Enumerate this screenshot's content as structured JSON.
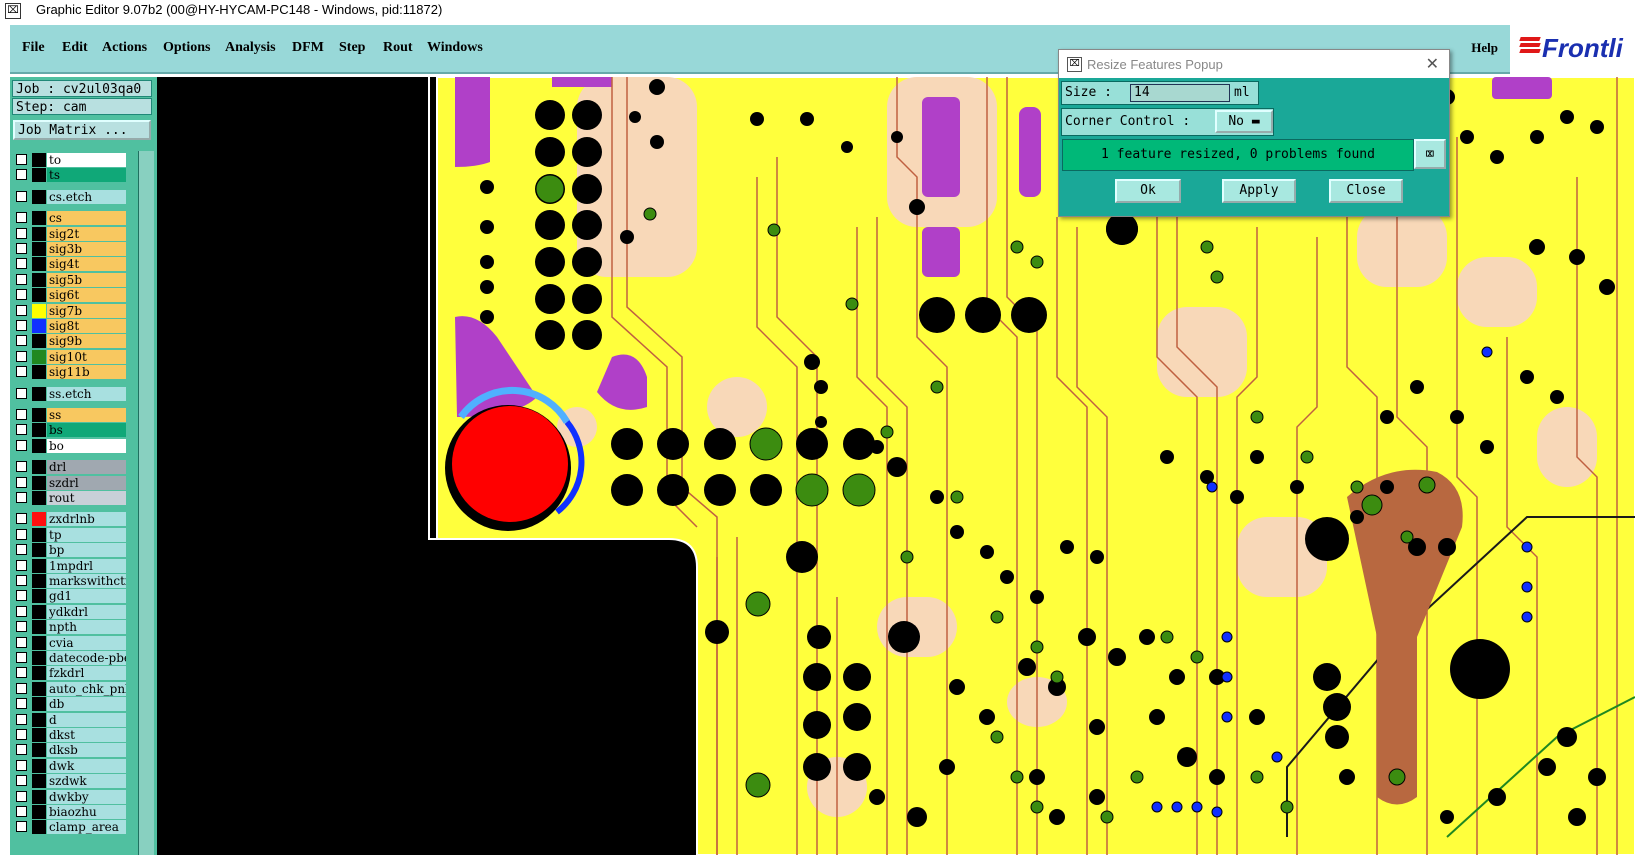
{
  "window": {
    "title": "Graphic Editor 9.07b2 (00@HY-HYCAM-PC148 - Windows, pid:11872)"
  },
  "menu": [
    "File",
    "Edit",
    "Actions",
    "Options",
    "Analysis",
    "DFM",
    "Step",
    "Rout",
    "Windows"
  ],
  "help": "Help",
  "logo": "Frontli",
  "job": {
    "job_label": "Job : cv2ul03qa0",
    "step_label": "Step: cam",
    "matrix_button": "Job Matrix ..."
  },
  "layers": [
    {
      "name": "to",
      "bg": "#ffffff",
      "sw": "#000000"
    },
    {
      "name": "ts",
      "bg": "#10a878",
      "sw": "#000000"
    },
    {
      "name": "cs.etch",
      "bg": "#a8e0e0",
      "sw": "#000000",
      "gap": true
    },
    {
      "name": "cs",
      "bg": "#f8c860",
      "sw": "#000000",
      "gap": true
    },
    {
      "name": "sig2t",
      "bg": "#f8c860",
      "sw": "#000000"
    },
    {
      "name": "sig3b",
      "bg": "#f8c860",
      "sw": "#000000"
    },
    {
      "name": "sig4t",
      "bg": "#f8c860",
      "sw": "#000000"
    },
    {
      "name": "sig5b",
      "bg": "#f8c860",
      "sw": "#000000"
    },
    {
      "name": "sig6t",
      "bg": "#f8c860",
      "sw": "#000000"
    },
    {
      "name": "sig7b",
      "bg": "#f8c860",
      "sw": "#ffff00"
    },
    {
      "name": "sig8t",
      "bg": "#f8c860",
      "sw": "#1030ff"
    },
    {
      "name": "sig9b",
      "bg": "#f8c860",
      "sw": "#000000"
    },
    {
      "name": "sig10t",
      "bg": "#f8c860",
      "sw": "#208820"
    },
    {
      "name": "sig11b",
      "bg": "#f8c860",
      "sw": "#000000"
    },
    {
      "name": "ss.etch",
      "bg": "#a8e0e0",
      "sw": "#000000",
      "gap": true
    },
    {
      "name": "ss",
      "bg": "#f8c860",
      "sw": "#000000",
      "gap": true
    },
    {
      "name": "bs",
      "bg": "#10a878",
      "sw": "#000000"
    },
    {
      "name": "bo",
      "bg": "#ffffff",
      "sw": "#000000"
    },
    {
      "name": "drl",
      "bg": "#a0a8b0",
      "sw": "#000000",
      "gap": true
    },
    {
      "name": "szdrl",
      "bg": "#a0a8b0",
      "sw": "#000000"
    },
    {
      "name": "rout",
      "bg": "#c8d0d8",
      "sw": "#000000"
    },
    {
      "name": "zxdrlnb",
      "bg": "#a8e0e0",
      "sw": "#ff1010",
      "gap": true
    },
    {
      "name": "tp",
      "bg": "#a8e0e0",
      "sw": "#000000"
    },
    {
      "name": "bp",
      "bg": "#a8e0e0",
      "sw": "#000000"
    },
    {
      "name": "1mpdrl",
      "bg": "#a8e0e0",
      "sw": "#000000"
    },
    {
      "name": "markswithcti",
      "bg": "#a8e0e0",
      "sw": "#000000"
    },
    {
      "name": "gd1",
      "bg": "#a8e0e0",
      "sw": "#000000"
    },
    {
      "name": "ydkdrl",
      "bg": "#a8e0e0",
      "sw": "#000000"
    },
    {
      "name": "npth",
      "bg": "#a8e0e0",
      "sw": "#000000"
    },
    {
      "name": "cvia",
      "bg": "#a8e0e0",
      "sw": "#000000"
    },
    {
      "name": "datecode-pbe",
      "bg": "#a8e0e0",
      "sw": "#000000"
    },
    {
      "name": "fzkdrl",
      "bg": "#a8e0e0",
      "sw": "#000000"
    },
    {
      "name": "auto_chk_pnl",
      "bg": "#a8e0e0",
      "sw": "#000000"
    },
    {
      "name": "db",
      "bg": "#a8e0e0",
      "sw": "#000000"
    },
    {
      "name": "d",
      "bg": "#a8e0e0",
      "sw": "#000000"
    },
    {
      "name": "dkst",
      "bg": "#a8e0e0",
      "sw": "#000000"
    },
    {
      "name": "dksb",
      "bg": "#a8e0e0",
      "sw": "#000000"
    },
    {
      "name": "dwk",
      "bg": "#a8e0e0",
      "sw": "#000000"
    },
    {
      "name": "szdwk",
      "bg": "#a8e0e0",
      "sw": "#000000"
    },
    {
      "name": "dwkby",
      "bg": "#a8e0e0",
      "sw": "#000000"
    },
    {
      "name": "biaozhu",
      "bg": "#a8e0e0",
      "sw": "#000000"
    },
    {
      "name": "clamp_area",
      "bg": "#a8e0e0",
      "sw": "#000000"
    }
  ],
  "dialog": {
    "title": "Resize Features Popup",
    "size_label": "Size :",
    "size_value": "14",
    "size_unit": "ml",
    "corner_label": "Corner Control :",
    "corner_value": "No",
    "message": "1 feature resized, 0 problems found",
    "ok": "Ok",
    "apply": "Apply",
    "close": "Close"
  },
  "colors": {
    "board_yellow": "#ffff3c",
    "trace": "#c06040",
    "pad_green": "#3c8c10",
    "magenta": "#b040c8",
    "peach": "#f8d8b8",
    "brown": "#b86840",
    "blue_pad": "#1030ff",
    "selected_red": "#ff0000"
  }
}
